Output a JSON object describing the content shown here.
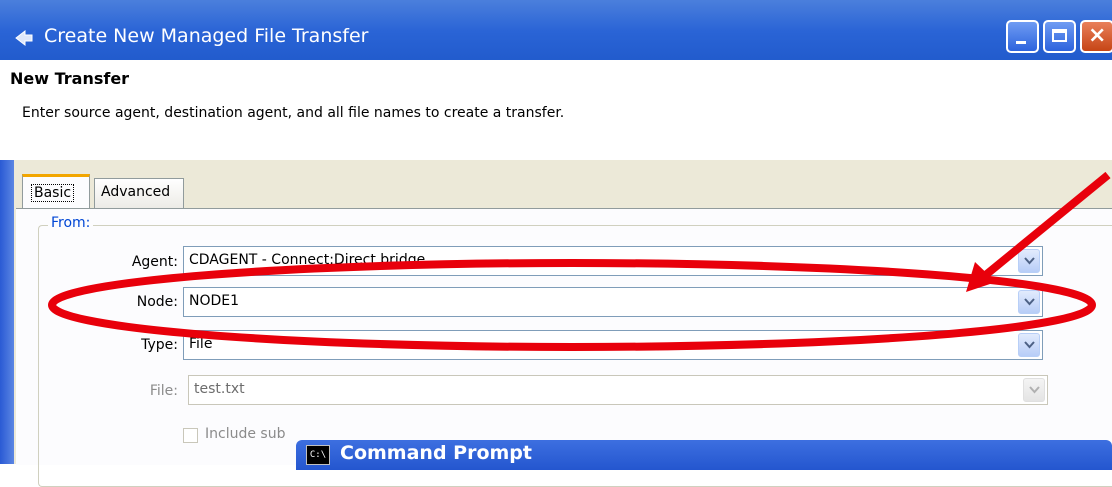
{
  "window": {
    "title": "Create New Managed File Transfer"
  },
  "header": {
    "title": "New Transfer",
    "description": "Enter source agent, destination agent, and all file names to create a transfer."
  },
  "tabs": [
    {
      "label": "Basic",
      "selected": true
    },
    {
      "label": "Advanced",
      "selected": false
    }
  ],
  "from_group": {
    "label": "From:",
    "agent": {
      "label": "Agent:",
      "value": "CDAGENT - Connect:Direct bridge"
    },
    "node": {
      "label": "Node:",
      "value": "NODE1"
    },
    "type": {
      "label": "Type:",
      "value": "File"
    },
    "file": {
      "label": "File:",
      "value": "test.txt",
      "disabled": true
    },
    "include_subdirs": {
      "label": "Include sub",
      "checked": false,
      "disabled": true
    }
  },
  "command_prompt": {
    "title": "Command Prompt",
    "icon_text": "C:\\"
  },
  "colors": {
    "title_bar": "#2a64d6",
    "annotation": "#e8000b",
    "group_label": "#0046d5"
  }
}
